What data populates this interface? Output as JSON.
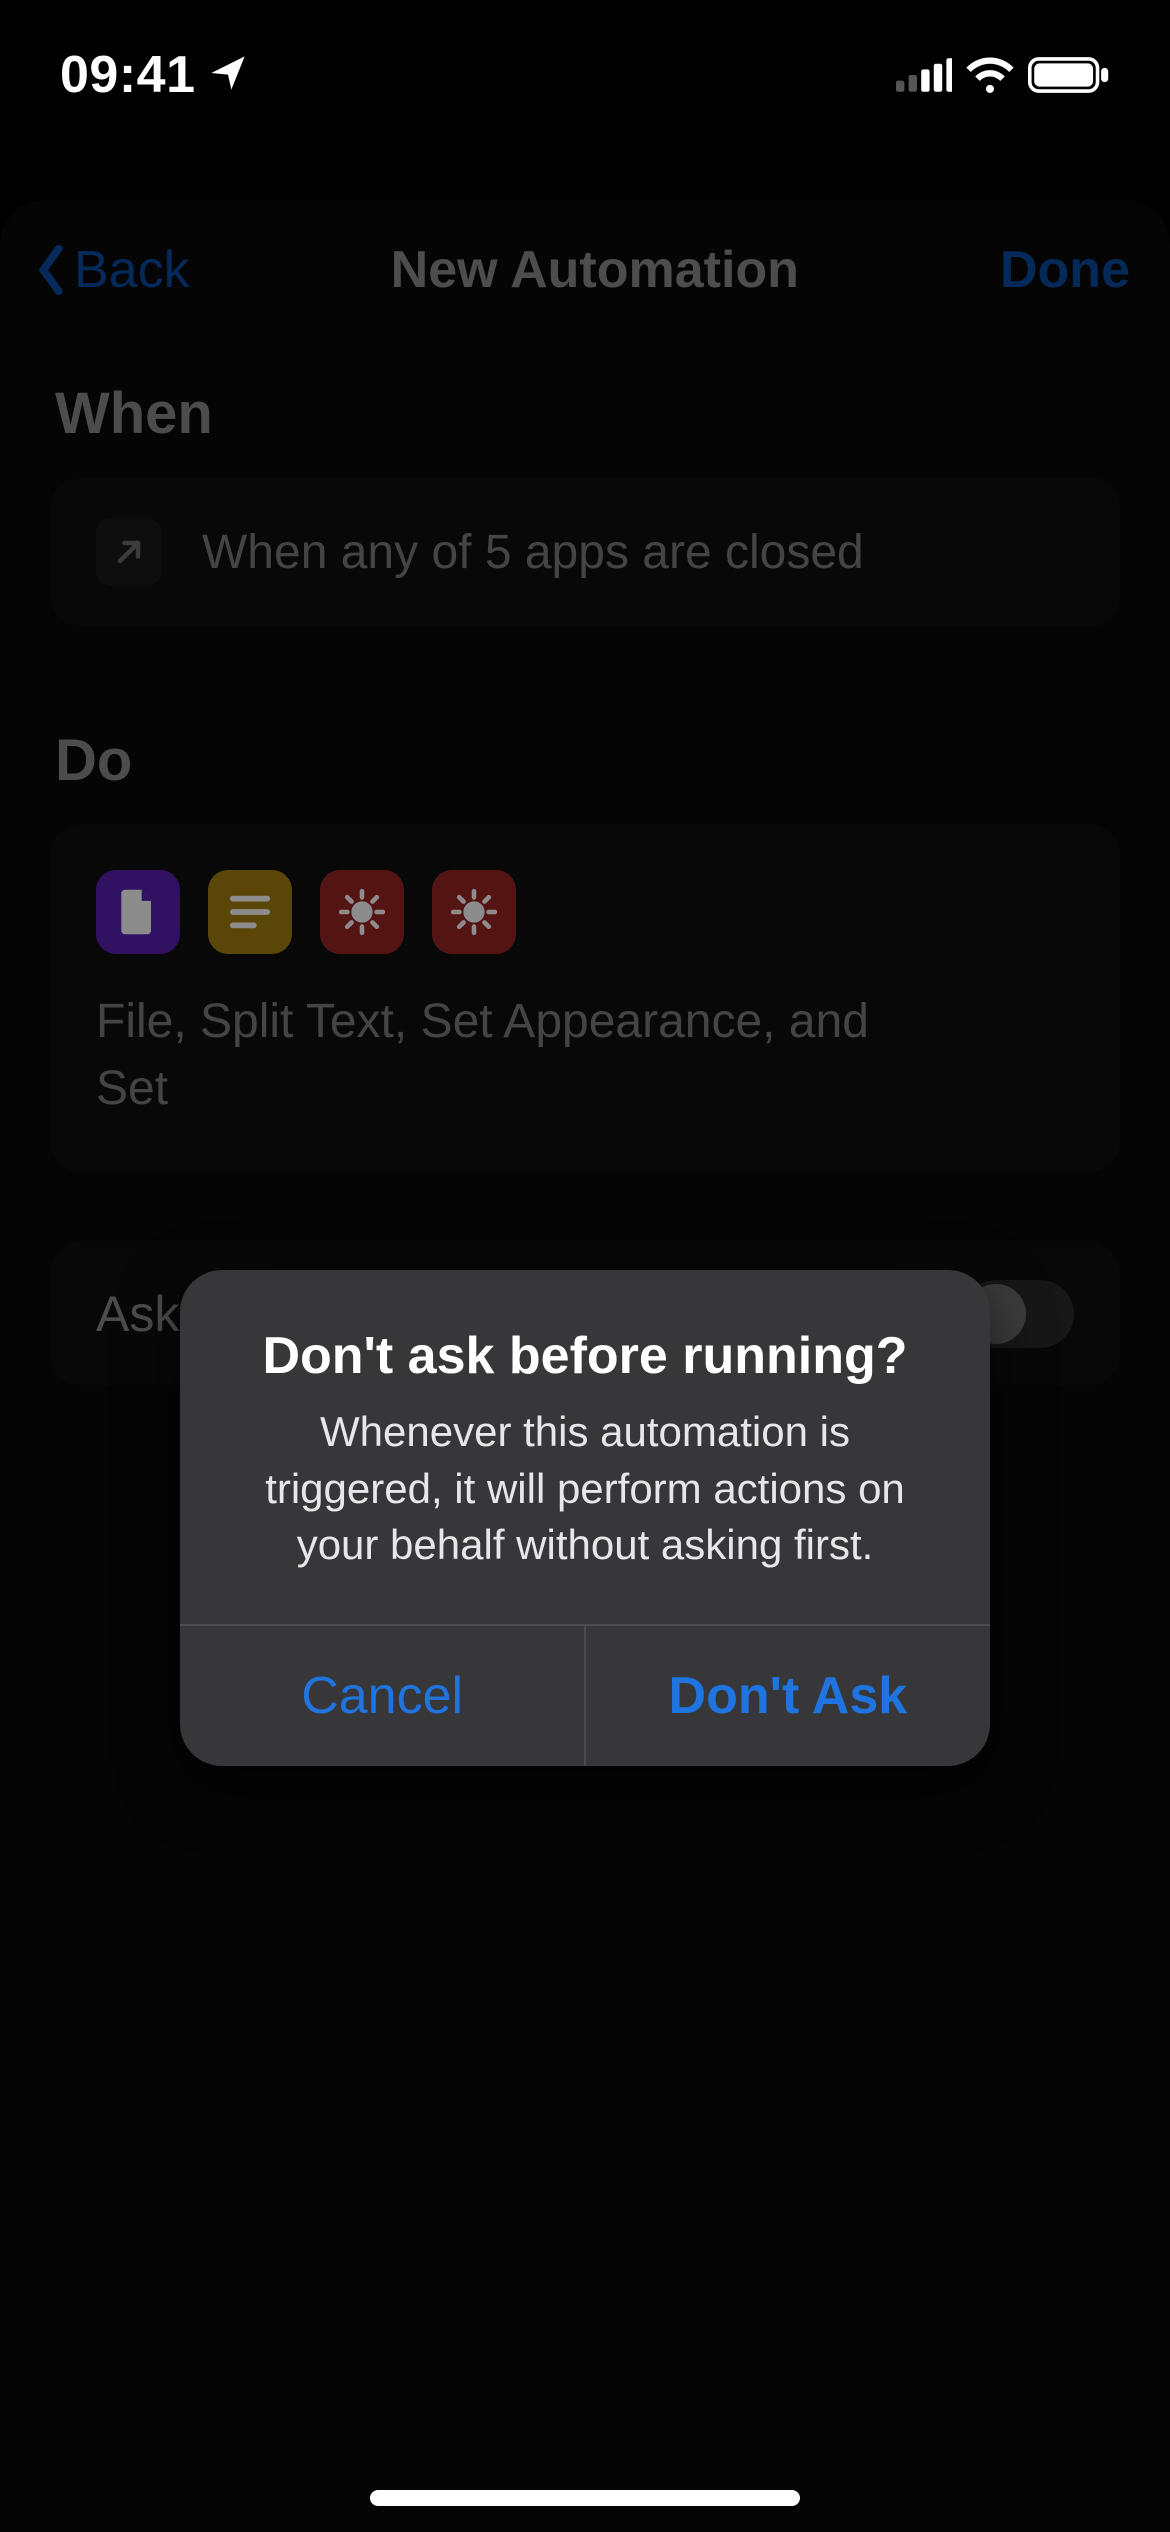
{
  "status_bar": {
    "time": "09:41",
    "location_icon": "location-arrow-icon",
    "cellular_icon": "cellular-signal-icon",
    "wifi_icon": "wifi-icon",
    "battery_icon": "battery-full-icon"
  },
  "nav": {
    "back_label": "Back",
    "title": "New Automation",
    "done_label": "Done"
  },
  "sections": {
    "when_header": "When",
    "do_header": "Do"
  },
  "when": {
    "icon": "open-app-icon",
    "text": "When any of 5 apps are closed"
  },
  "do": {
    "action_icons": [
      "file-icon",
      "text-lines-icon",
      "sun-icon",
      "sun-icon"
    ],
    "summary": "File, Split Text, Set Appearance, and Set "
  },
  "ask_row": {
    "label": "Ask",
    "toggle_on": false
  },
  "alert": {
    "title": "Don't ask before running?",
    "message": "Whenever this automation is triggered, it will perform actions on your behalf without asking first.",
    "cancel_label": "Cancel",
    "confirm_label": "Don't Ask"
  },
  "colors": {
    "tint": "#1f74e0",
    "purple": "#5a1fb3",
    "yellow": "#a38010",
    "red": "#9c2526"
  }
}
